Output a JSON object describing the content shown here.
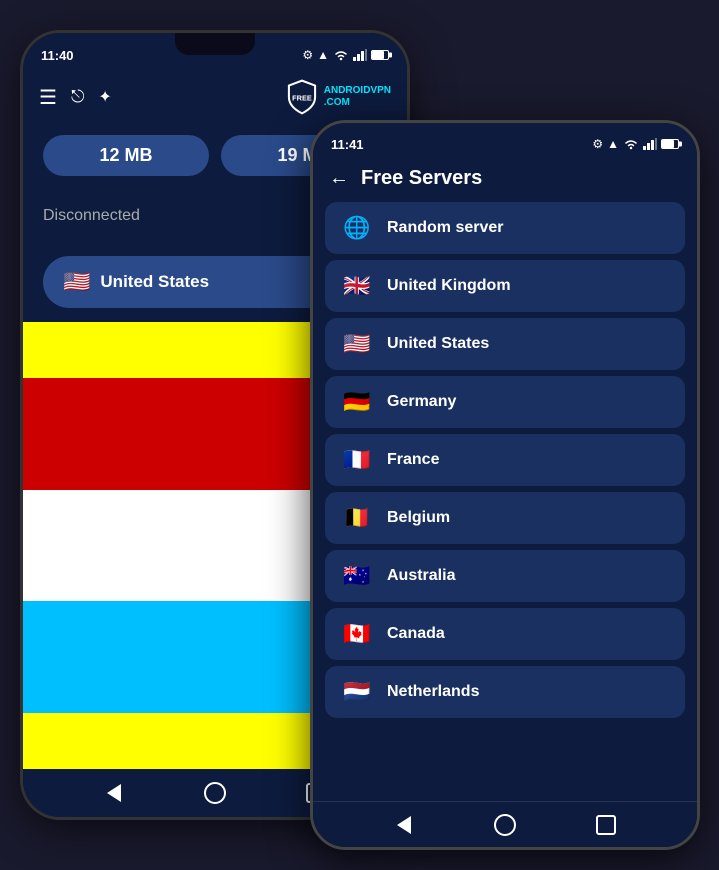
{
  "phone1": {
    "statusBar": {
      "time": "11:40",
      "settingsIcon": "gear-icon",
      "alertIcon": "alert-icon"
    },
    "toolbar": {
      "menuIcon": "menu-icon",
      "shareIcon": "share-icon",
      "starIcon": "star-icon",
      "logoText": "FREE",
      "logoSubText": "ANDROIDVPN",
      "logoDomain": ".COM"
    },
    "stats": {
      "download": "12 MB",
      "upload": "19 MB"
    },
    "status": "Disconnected",
    "countrySelector": {
      "flag": "🇺🇸",
      "country": "United States"
    },
    "flagStrips": [
      {
        "color": "#FFFF00"
      },
      {
        "color": "#CC0000"
      },
      {
        "color": "#CC0000"
      },
      {
        "color": "#FFFFFF"
      },
      {
        "color": "#FFFFFF"
      },
      {
        "color": "#00BFFF"
      },
      {
        "color": "#00BFFF"
      },
      {
        "color": "#FFFF00"
      }
    ]
  },
  "phone2": {
    "statusBar": {
      "time": "11:41",
      "settingsIcon": "gear-icon"
    },
    "header": {
      "backLabel": "←",
      "title": "Free Servers"
    },
    "servers": [
      {
        "flag": "🌐",
        "name": "Random server",
        "type": "globe"
      },
      {
        "flag": "🇬🇧",
        "name": "United Kingdom",
        "type": "flag"
      },
      {
        "flag": "🇺🇸",
        "name": "United States",
        "type": "flag"
      },
      {
        "flag": "🇩🇪",
        "name": "Germany",
        "type": "flag"
      },
      {
        "flag": "🇫🇷",
        "name": "France",
        "type": "flag"
      },
      {
        "flag": "🇧🇪",
        "name": "Belgium",
        "type": "flag"
      },
      {
        "flag": "🇦🇺",
        "name": "Australia",
        "type": "flag"
      },
      {
        "flag": "🇨🇦",
        "name": "Canada",
        "type": "flag"
      },
      {
        "flag": "🇳🇱",
        "name": "Netherlands",
        "type": "flag"
      }
    ]
  }
}
